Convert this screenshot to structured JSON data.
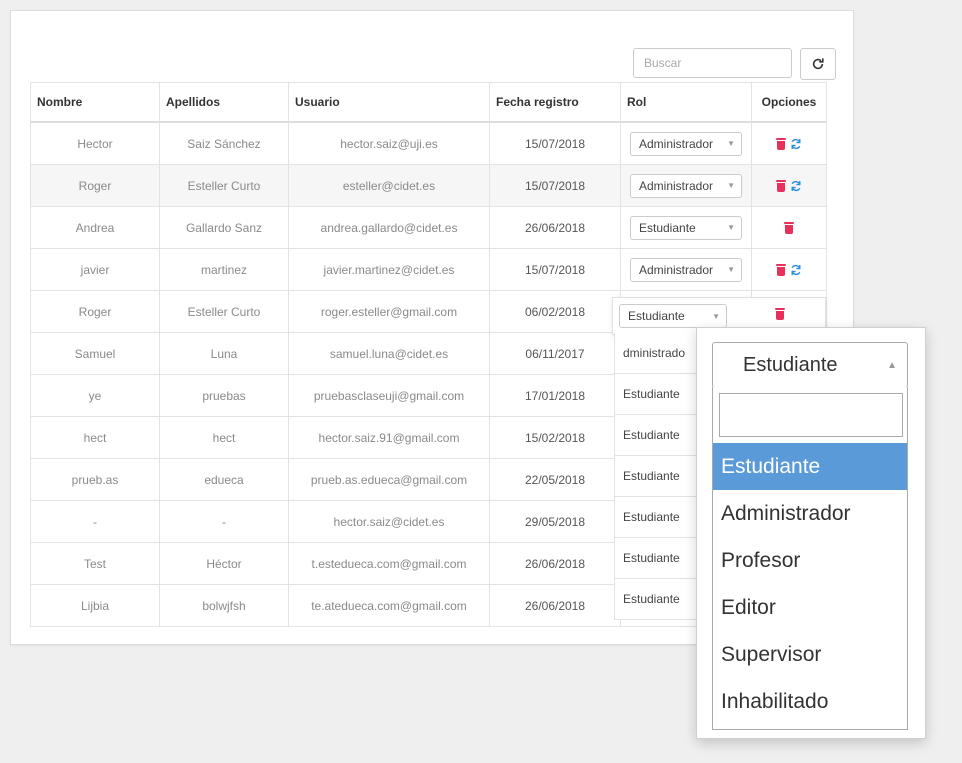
{
  "toolbar": {
    "search_placeholder": "Buscar"
  },
  "table": {
    "headers": [
      "Nombre",
      "Apellidos",
      "Usuario",
      "Fecha registro",
      "Rol",
      "Opciones"
    ],
    "rows": [
      {
        "nombre": "Hector",
        "apellidos": "Saiz Sánchez",
        "usuario": "hector.saiz@uji.es",
        "fecha": "15/07/2018",
        "rol": "Administrador",
        "sync": true
      },
      {
        "nombre": "Roger",
        "apellidos": "Esteller Curto",
        "usuario": "esteller@cidet.es",
        "fecha": "15/07/2018",
        "rol": "Administrador",
        "sync": true
      },
      {
        "nombre": "Andrea",
        "apellidos": "Gallardo Sanz",
        "usuario": "andrea.gallardo@cidet.es",
        "fecha": "26/06/2018",
        "rol": "Estudiante",
        "sync": false
      },
      {
        "nombre": "javier",
        "apellidos": "martinez",
        "usuario": "javier.martinez@cidet.es",
        "fecha": "15/07/2018",
        "rol": "Administrador",
        "sync": true
      },
      {
        "nombre": "Roger",
        "apellidos": "Esteller Curto",
        "usuario": "roger.esteller@gmail.com",
        "fecha": "06/02/2018",
        "rol": "Estudiante",
        "sync": false
      },
      {
        "nombre": "Samuel",
        "apellidos": "Luna",
        "usuario": "samuel.luna@cidet.es",
        "fecha": "06/11/2017",
        "rol": "Administrador",
        "sync": false
      },
      {
        "nombre": "ye",
        "apellidos": "pruebas",
        "usuario": "pruebasclaseuji@gmail.com",
        "fecha": "17/01/2018",
        "rol": "Estudiante",
        "sync": false
      },
      {
        "nombre": "hect",
        "apellidos": "hect",
        "usuario": "hector.saiz.91@gmail.com",
        "fecha": "15/02/2018",
        "rol": "Estudiante",
        "sync": false
      },
      {
        "nombre": "prueb.as",
        "apellidos": "edueca",
        "usuario": "prueb.as.edueca@gmail.com",
        "fecha": "22/05/2018",
        "rol": "Estudiante",
        "sync": false
      },
      {
        "nombre": "-",
        "apellidos": "-",
        "usuario": "hector.saiz@cidet.es",
        "fecha": "29/05/2018",
        "rol": "Estudiante",
        "sync": false
      },
      {
        "nombre": "Test",
        "apellidos": "Héctor",
        "usuario": "t.estedueca.com@gmail.com",
        "fecha": "26/06/2018",
        "rol": "Estudiante",
        "sync": false
      },
      {
        "nombre": "Lijbia",
        "apellidos": "bolwjfsh",
        "usuario": "te.atedueca.com@gmail.com",
        "fecha": "26/06/2018",
        "rol": "Estudiante",
        "sync": false
      }
    ]
  },
  "overlay": {
    "active_rol": "Estudiante",
    "truncated": [
      "dministrado",
      "Estudiante",
      "Estudiante",
      "Estudiante",
      "Estudiante",
      "Estudiante",
      "Estudiante"
    ]
  },
  "dropdown": {
    "selected": "Estudiante",
    "options": [
      "Estudiante",
      "Administrador",
      "Profesor",
      "Editor",
      "Supervisor",
      "Inhabilitado"
    ],
    "highlighted_index": 0
  },
  "colors": {
    "trash": "#e8305d",
    "sync": "#2d8fe0",
    "highlight": "#5b9ad8"
  },
  "icons": {
    "refresh": "refresh-icon",
    "trash": "trash-icon",
    "sync": "sync-icon",
    "caret": "caret-down-icon"
  }
}
